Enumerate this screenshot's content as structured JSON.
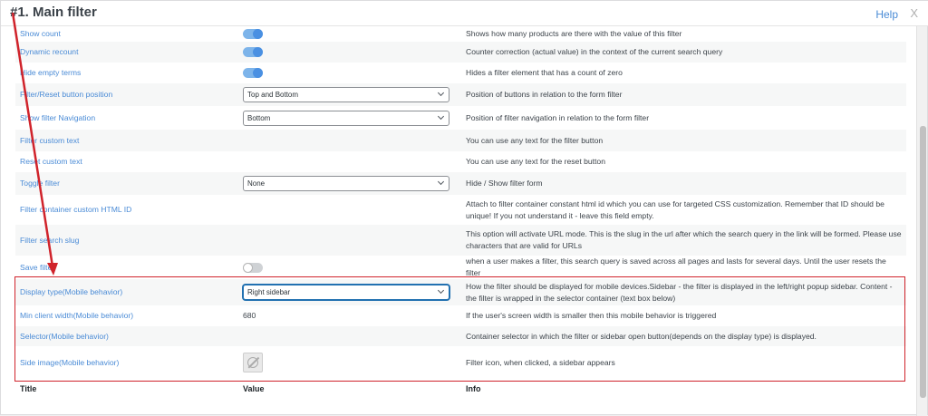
{
  "dialog": {
    "title": "#1. Main filter",
    "help_label": "Help",
    "close_label": "X"
  },
  "rows": [
    {
      "label": "Show count",
      "value_type": "toggle",
      "toggle_on": true,
      "info": "Shows how many products are there with the value of this filter"
    },
    {
      "label": "Dynamic recount",
      "value_type": "toggle",
      "toggle_on": true,
      "info": "Counter correction (actual value) in the context of the current search query"
    },
    {
      "label": "Hide empty terms",
      "value_type": "toggle",
      "toggle_on": true,
      "info": "Hides a filter element that has a count of zero"
    },
    {
      "label": "Filter/Reset button position",
      "value_type": "select",
      "value": "Top and Bottom",
      "info": "Position of buttons in relation to the form filter"
    },
    {
      "label": "Show filter Navigation",
      "value_type": "select",
      "value": "Bottom",
      "info": "Position of filter navigation in relation to the form filter"
    },
    {
      "label": "Filter custom text",
      "value_type": "text",
      "value": "",
      "info": "You can use any text for the filter button"
    },
    {
      "label": "Reset custom text",
      "value_type": "text",
      "value": "",
      "info": "You can use any text for the reset button"
    },
    {
      "label": "Toggle filter",
      "value_type": "select",
      "value": "None",
      "info": "Hide / Show filter form"
    },
    {
      "label": "Filter container custom HTML ID",
      "value_type": "text",
      "value": "",
      "info": "Attach to filter container constant html id which you can use for targeted CSS customization. Remember that ID should be unique! If you not understand it - leave this field empty."
    },
    {
      "label": "Filter search slug",
      "value_type": "text",
      "value": "",
      "info": "This option will activate URL mode. This is the slug in the url after which the search query in the link will be formed. Please use characters that are valid for URLs"
    },
    {
      "label": "Save filter",
      "value_type": "toggle",
      "toggle_on": false,
      "info": "when a user makes a filter, this search query is saved across all pages and lasts for several days. Until the user resets the filter"
    },
    {
      "label": "Display type(Mobile behavior)",
      "value_type": "select",
      "value": "Right sidebar",
      "focused": true,
      "info": "How the filter should be displayed for mobile devices.Sidebar - the filter is displayed in the left/right popup sidebar. Content - the filter is wrapped in the selector container (text box below)"
    },
    {
      "label": "Min client width(Mobile behavior)",
      "value_type": "text",
      "value": "680",
      "info": "If the user's screen width is smaller then this mobile behavior is triggered"
    },
    {
      "label": "Selector(Mobile behavior)",
      "value_type": "text",
      "value": "",
      "info": "Container selector in which the filter or sidebar open button(depends on the display type) is displayed."
    },
    {
      "label": "Side image(Mobile behavior)",
      "value_type": "image",
      "value": "",
      "info": "Filter icon, when clicked, a sidebar appears"
    }
  ],
  "footer": {
    "col_title": "Title",
    "col_value": "Value",
    "col_info": "Info"
  },
  "colors": {
    "accent": "#4a8bd6",
    "annotation_red": "#d0232b",
    "toggle_on": "#4a90e2"
  }
}
